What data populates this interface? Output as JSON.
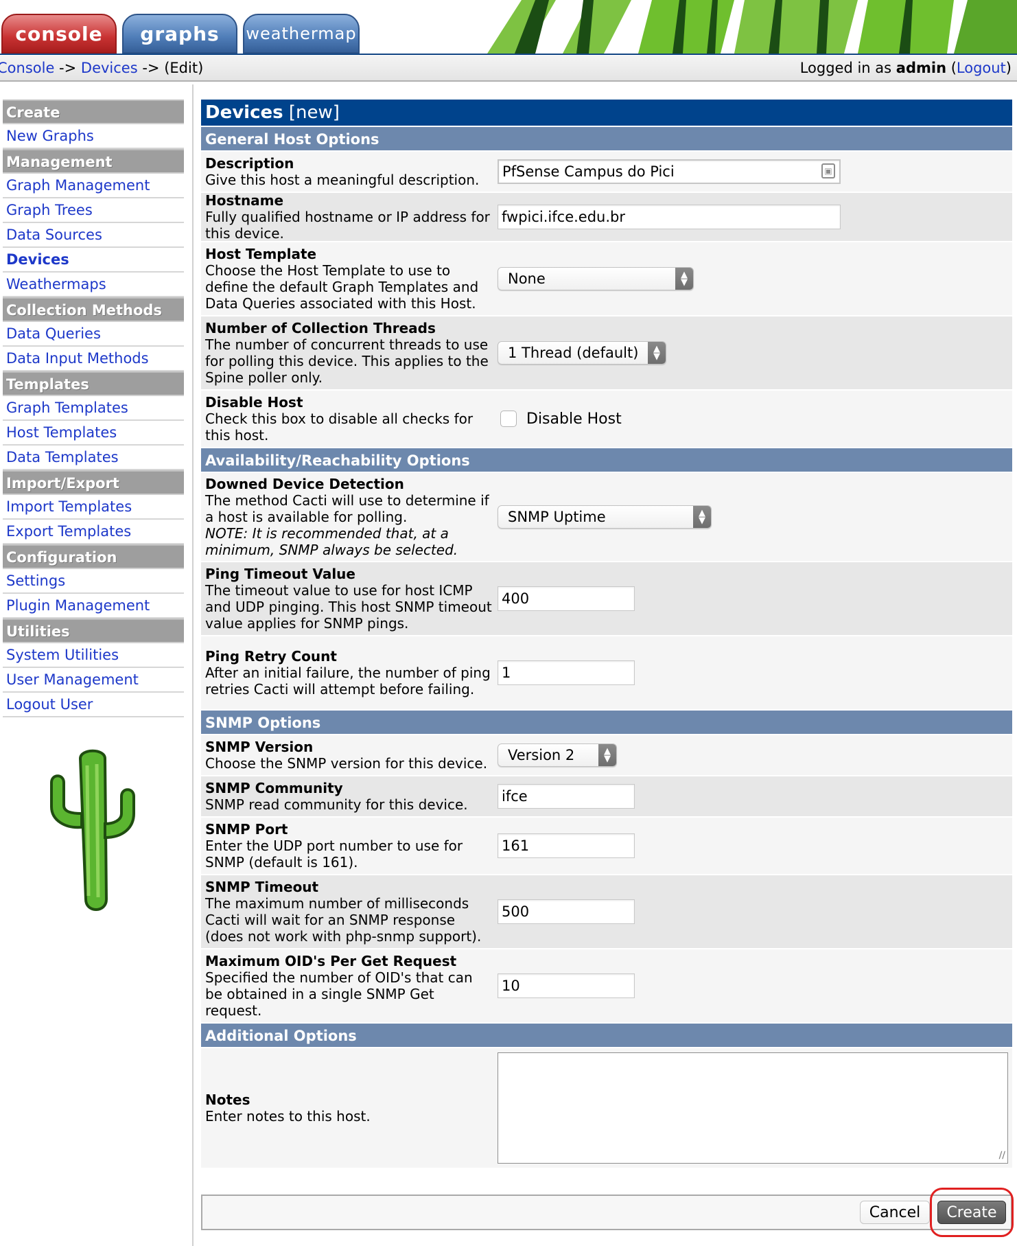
{
  "tabs": [
    {
      "label": "console"
    },
    {
      "label": "graphs"
    },
    {
      "label": "weathermap"
    }
  ],
  "breadcrumb": {
    "console": "Console",
    "sep1": " -> ",
    "devices": "Devices",
    "sep2": " -> ",
    "edit": "(Edit)"
  },
  "login": {
    "prefix": "Logged in as ",
    "user": "admin",
    "open": " (",
    "logout": "Logout",
    "close": ")"
  },
  "sidebar": {
    "create_head": "Create",
    "new_graphs": "New Graphs",
    "management_head": "Management",
    "graph_management": "Graph Management",
    "graph_trees": "Graph Trees",
    "data_sources": "Data Sources",
    "devices": "Devices",
    "weathermaps": "Weathermaps",
    "collection_head": "Collection Methods",
    "data_queries": "Data Queries",
    "data_input_methods": "Data Input Methods",
    "templates_head": "Templates",
    "graph_templates": "Graph Templates",
    "host_templates": "Host Templates",
    "data_templates": "Data Templates",
    "import_export_head": "Import/Export",
    "import_templates": "Import Templates",
    "export_templates": "Export Templates",
    "configuration_head": "Configuration",
    "settings": "Settings",
    "plugin_management": "Plugin Management",
    "utilities_head": "Utilities",
    "system_utilities": "System Utilities",
    "user_management": "User Management",
    "logout_user": "Logout User"
  },
  "main": {
    "title": "Devices",
    "title_suffix": " [new]",
    "sections": {
      "general": "General Host Options",
      "availability": "Availability/Reachability Options",
      "snmp": "SNMP Options",
      "additional": "Additional Options"
    },
    "fields": {
      "description": {
        "title": "Description",
        "desc": "Give this host a meaningful description.",
        "value": "PfSense Campus do Pici"
      },
      "hostname": {
        "title": "Hostname",
        "desc": "Fully qualified hostname or IP address for this device.",
        "value": "fwpici.ifce.edu.br"
      },
      "host_template": {
        "title": "Host Template",
        "desc": "Choose the Host Template to use to define the default Graph Templates and Data Queries associated with this Host.",
        "value": "None"
      },
      "threads": {
        "title": "Number of Collection Threads",
        "desc": "The number of concurrent threads to use for polling this device. This applies to the Spine poller only.",
        "value": "1 Thread (default)"
      },
      "disable_host": {
        "title": "Disable Host",
        "desc": "Check this box to disable all checks for this host.",
        "checkbox_label": "Disable Host"
      },
      "downed_detection": {
        "title": "Downed Device Detection",
        "desc": "The method Cacti will use to determine if a host is available for polling.",
        "note": "NOTE: It is recommended that, at a minimum, SNMP always be selected.",
        "value": "SNMP Uptime"
      },
      "ping_timeout": {
        "title": "Ping Timeout Value",
        "desc": "The timeout value to use for host ICMP and UDP pinging. This host SNMP timeout value applies for SNMP pings.",
        "value": "400"
      },
      "ping_retry": {
        "title": "Ping Retry Count",
        "desc": "After an initial failure, the number of ping retries Cacti will attempt before failing.",
        "value": "1"
      },
      "snmp_version": {
        "title": "SNMP Version",
        "desc": "Choose the SNMP version for this device.",
        "value": "Version 2"
      },
      "snmp_community": {
        "title": "SNMP Community",
        "desc": "SNMP read community for this device.",
        "value": "ifce"
      },
      "snmp_port": {
        "title": "SNMP Port",
        "desc": "Enter the UDP port number to use for SNMP (default is 161).",
        "value": "161"
      },
      "snmp_timeout": {
        "title": "SNMP Timeout",
        "desc": "The maximum number of milliseconds Cacti will wait for an SNMP response (does not work with php-snmp support).",
        "value": "500"
      },
      "max_oids": {
        "title": "Maximum OID's Per Get Request",
        "desc": "Specified the number of OID's that can be obtained in a single SNMP Get request.",
        "value": "10"
      },
      "notes": {
        "title": "Notes",
        "desc": "Enter notes to this host.",
        "value": ""
      }
    }
  },
  "buttons": {
    "cancel": "Cancel",
    "create": "Create"
  },
  "colors": {
    "title_bar": "#00438c",
    "section_head": "#6d88ad",
    "link": "#1d38c9",
    "highlight": "#e02020"
  }
}
